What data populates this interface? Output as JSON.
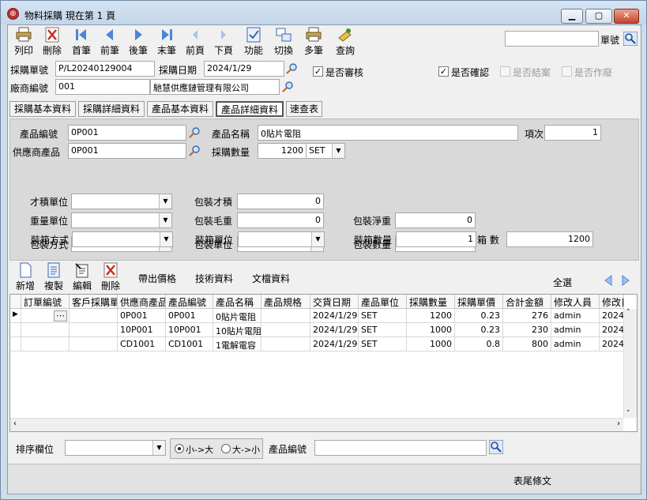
{
  "window": {
    "title": "物料採購  現在第 1 頁",
    "minimize": "▁",
    "maximize": "▢",
    "close": "✕"
  },
  "toolbar": {
    "buttons": [
      "列印",
      "刪除",
      "首筆",
      "前筆",
      "後筆",
      "末筆",
      "前頁",
      "下頁",
      "功能",
      "切換",
      "多筆",
      "查詢"
    ],
    "search_value": "",
    "search_label": "單號"
  },
  "header": {
    "po_no_label": "採購單號",
    "po_no": "P/L20240129004",
    "po_date_label": "採購日期",
    "po_date": "2024/1/29",
    "approved_label": "是否審核",
    "approved": "✓",
    "confirmed_label": "是否確認",
    "confirmed": "✓",
    "closed_label": "是否結案",
    "void_label": "是否作廢",
    "vendor_no_label": "廠商編號",
    "vendor_no": "001",
    "vendor_name": "馳慧供應鏈管理有限公司"
  },
  "tabs": [
    "採購基本資料",
    "採購詳細資料",
    "產品基本資料",
    "產品詳細資料",
    "速查表"
  ],
  "detail": {
    "prod_no_label": "產品編號",
    "prod_no": "0P001",
    "prod_name_label": "產品名稱",
    "prod_name": "0貼片電阻",
    "item_label": "項次",
    "item": "1",
    "supplier_prod_label": "供應商產品",
    "supplier_prod": "0P001",
    "qty_label": "採購數量",
    "qty": "1200",
    "qty_unit": "SET",
    "cuft_unit_label": "才積單位",
    "pack_cuft_label": "包裝才積",
    "pack_cuft": "0",
    "weight_unit_label": "重量單位",
    "pack_gross_label": "包裝毛重",
    "pack_gross": "0",
    "pack_net_label": "包裝淨重",
    "pack_net": "0",
    "pack_method_label": "包裝方式",
    "pack_unit_label": "包裝單位",
    "pack_qty_label": "包裝數量",
    "pack_qty": "1",
    "box_method_label": "裝箱方式",
    "box_unit_label": "裝箱單位",
    "box_qty_label": "裝箱數量",
    "box_qty": "1",
    "box_count_label": "箱 數",
    "box_count": "1200"
  },
  "subtoolbar": {
    "buttons": [
      "新增",
      "複製",
      "編輯",
      "刪除"
    ],
    "links": [
      "帶出價格",
      "技術資料",
      "文檔資料"
    ],
    "select_all": "全選"
  },
  "grid": {
    "columns": [
      "訂單編號",
      "客戶採購單",
      "供應商產品",
      "產品編號",
      "產品名稱",
      "產品規格",
      "交貨日期",
      "產品單位",
      "採購數量",
      "採購單價",
      "合計金額",
      "修改人員",
      "修改日"
    ],
    "rows": [
      [
        "",
        "",
        "0P001",
        "0P001",
        "0貼片電阻",
        "",
        "2024/1/29",
        "SET",
        "1200",
        "0.23",
        "276",
        "admin",
        "2024/"
      ],
      [
        "",
        "",
        "10P001",
        "10P001",
        "10貼片電阻",
        "",
        "2024/1/29",
        "SET",
        "1000",
        "0.23",
        "230",
        "admin",
        "2024/"
      ],
      [
        "",
        "",
        "CD1001",
        "CD1001",
        "1電解電容",
        "",
        "2024/1/29",
        "SET",
        "1000",
        "0.8",
        "800",
        "admin",
        "2024/"
      ]
    ],
    "ellipsis": "⋯"
  },
  "sortbar": {
    "sort_field_label": "排序欄位",
    "asc_label": "小->大",
    "desc_label": "大->小",
    "prod_no_label": "產品編號",
    "prod_no_value": ""
  },
  "status": {
    "footer_text": "表尾條文"
  }
}
